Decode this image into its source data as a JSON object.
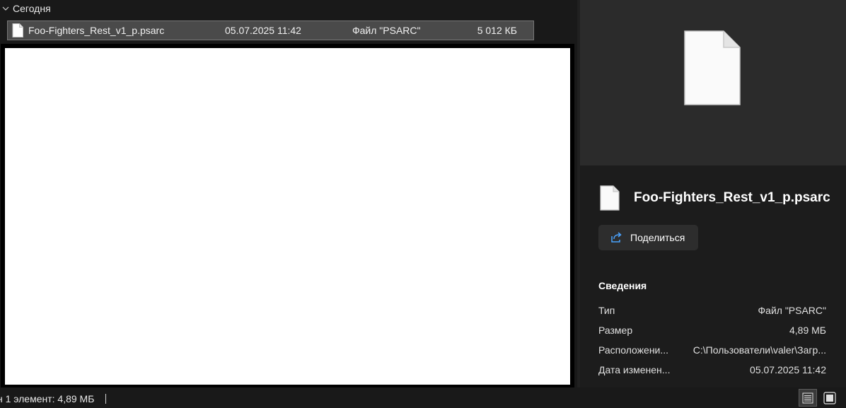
{
  "file_list": {
    "group_label": "Сегодня",
    "file": {
      "name": "Foo-Fighters_Rest_v1_p.psarc",
      "date_modified": "05.07.2025 11:42",
      "type": "Файл \"PSARC\"",
      "size": "5 012 КБ"
    }
  },
  "details": {
    "title": "Foo-Fighters_Rest_v1_p.psarc",
    "share_label": "Поделиться",
    "section_title": "Сведения",
    "properties": [
      {
        "label": "Тип",
        "value": "Файл \"PSARC\""
      },
      {
        "label": "Размер",
        "value": "4,89 МБ"
      },
      {
        "label": "Расположени...",
        "value": "C:\\Пользователи\\valer\\Загр..."
      },
      {
        "label": "Дата изменен...",
        "value": "05.07.2025 11:42"
      }
    ]
  },
  "status_bar": {
    "selection_text": "н 1 элемент: 4,89 МБ"
  },
  "icons": {
    "group_chevron": "chevron-down-icon",
    "file": "file-icon",
    "share": "share-icon",
    "view_details": "details-view-icon",
    "view_tiles": "tiles-view-icon"
  },
  "colors": {
    "background": "#191919",
    "selection": "#4a4a4a",
    "details_pane": "#1c1c1c",
    "thumb_area": "#2b2b2b",
    "accent_share": "#4aa3ff"
  }
}
